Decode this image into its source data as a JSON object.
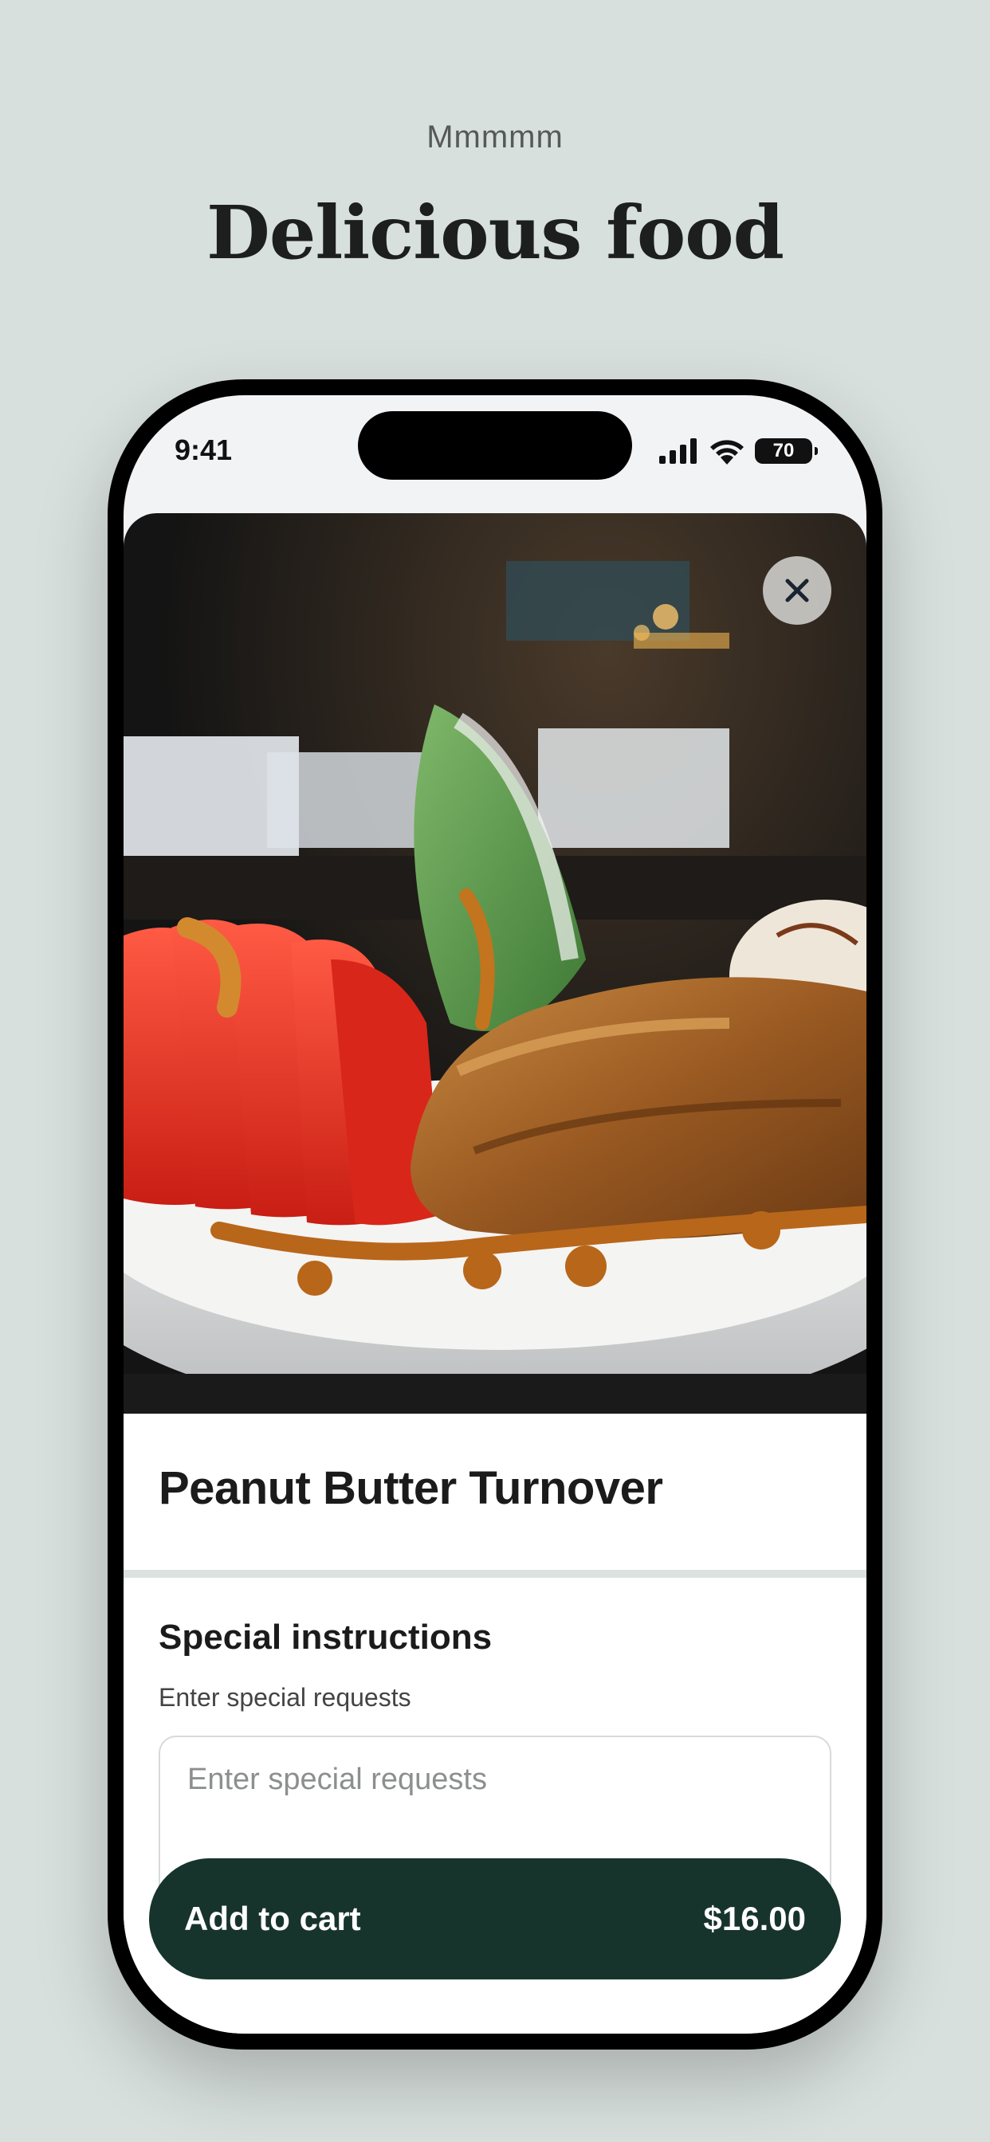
{
  "marketing": {
    "eyebrow": "Mmmmm",
    "headline": "Delicious food"
  },
  "status_bar": {
    "time": "9:41",
    "battery": "70",
    "icons": [
      "signal-icon",
      "wifi-icon",
      "battery-icon"
    ]
  },
  "item": {
    "image_alt": "dessert-photo",
    "title": "Peanut Butter Turnover",
    "close_icon": "close-icon"
  },
  "special_instructions": {
    "title": "Special instructions",
    "subtitle": "Enter special requests",
    "placeholder": "Enter special requests",
    "value": ""
  },
  "cart": {
    "label": "Add to cart",
    "price": "$16.00"
  },
  "colors": {
    "background": "#d8e0dd",
    "accent": "#17342c"
  }
}
